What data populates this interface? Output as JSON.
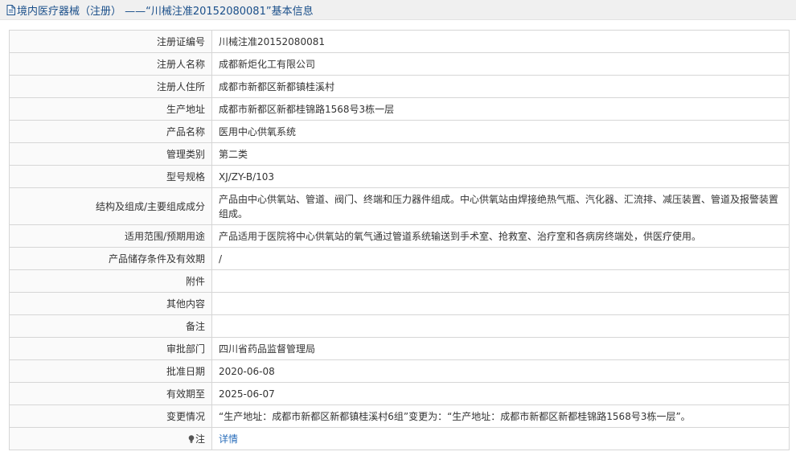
{
  "header": {
    "title": "境内医疗器械（注册） ——“川械注准20152080081”基本信息",
    "icon": "document-icon"
  },
  "rows": [
    {
      "label": "注册证编号",
      "value": "川械注准20152080081"
    },
    {
      "label": "注册人名称",
      "value": "成都新炬化工有限公司"
    },
    {
      "label": "注册人住所",
      "value": "成都市新都区新都镇桂溪村"
    },
    {
      "label": "生产地址",
      "value": "成都市新都区新都桂锦路1568号3栋一层"
    },
    {
      "label": "产品名称",
      "value": "医用中心供氧系统"
    },
    {
      "label": "管理类别",
      "value": "第二类"
    },
    {
      "label": "型号规格",
      "value": "XJ/ZY-B/103"
    },
    {
      "label": "结构及组成/主要组成成分",
      "value": "产品由中心供氧站、管道、阀门、终端和压力器件组成。中心供氧站由焊接绝热气瓶、汽化器、汇流排、减压装置、管道及报警装置组成。"
    },
    {
      "label": "适用范围/预期用途",
      "value": "产品适用于医院将中心供氧站的氧气通过管道系统输送到手术室、抢救室、治疗室和各病房终端处，供医疗使用。"
    },
    {
      "label": "产品储存条件及有效期",
      "value": "/"
    },
    {
      "label": "附件",
      "value": ""
    },
    {
      "label": "其他内容",
      "value": ""
    },
    {
      "label": "备注",
      "value": ""
    },
    {
      "label": "审批部门",
      "value": "四川省药品监督管理局"
    },
    {
      "label": "批准日期",
      "value": "2020-06-08"
    },
    {
      "label": "有效期至",
      "value": "2025-06-07"
    },
    {
      "label": "变更情况",
      "value": "“生产地址：成都市新都区新都镇桂溪村6组”变更为：“生产地址：成都市新都区新都桂锦路1568号3栋一层”。"
    }
  ],
  "note": {
    "label": "注",
    "icon": "lightbulb-icon",
    "link": "详情"
  },
  "colors": {
    "title": "#1a4f8a",
    "link": "#2a6ebb",
    "border": "#d6d6d6"
  }
}
